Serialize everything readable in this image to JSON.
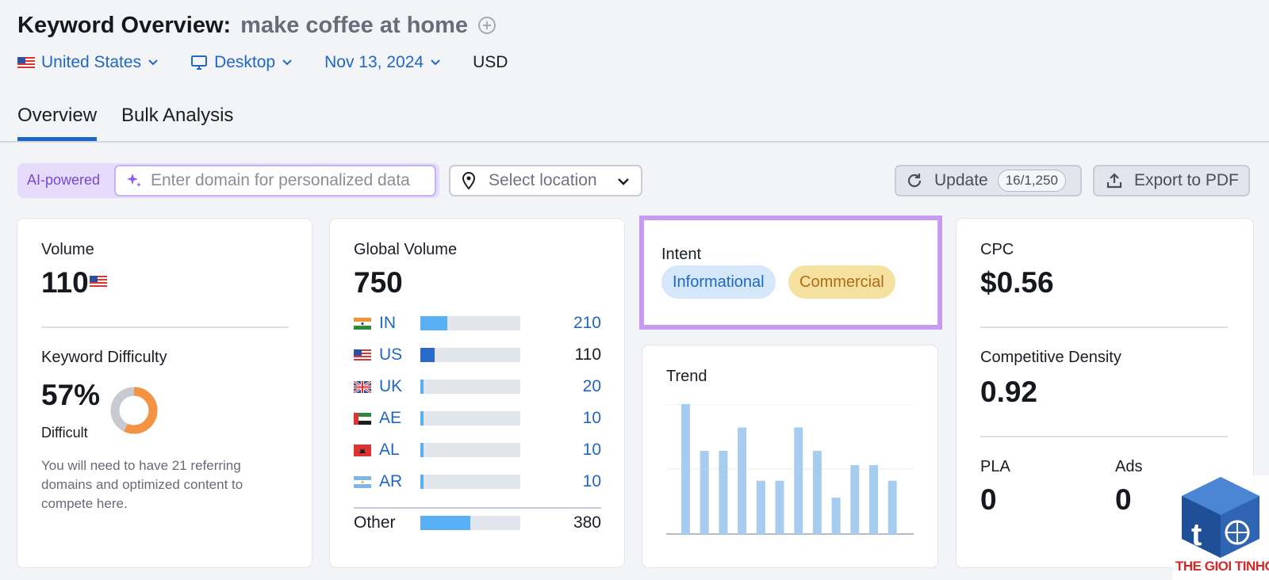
{
  "header": {
    "title_label": "Keyword Overview:",
    "keyword": "make coffee at home"
  },
  "filters": {
    "country": "United States",
    "device": "Desktop",
    "date": "Nov 13, 2024",
    "currency": "USD"
  },
  "tabs": [
    {
      "label": "Overview",
      "active": true
    },
    {
      "label": "Bulk Analysis",
      "active": false
    }
  ],
  "toolbar": {
    "ai_label": "AI-powered",
    "domain_placeholder": "Enter domain for personalized data",
    "location_placeholder": "Select location",
    "update_label": "Update",
    "update_count": "16/1,250",
    "export_label": "Export to PDF"
  },
  "volume": {
    "label": "Volume",
    "value": "110",
    "kd_label": "Keyword Difficulty",
    "kd_value": "57%",
    "kd_level": "Difficult",
    "kd_percent": 57,
    "kd_description": "You will need to have 21 referring domains and optimized content to compete here."
  },
  "global_volume": {
    "label": "Global Volume",
    "value": "750",
    "rows": [
      {
        "code": "IN",
        "value": "210",
        "fraction": 0.27,
        "color": "#5ab0f5",
        "link": true
      },
      {
        "code": "US",
        "value": "110",
        "fraction": 0.14,
        "color": "#2a6ac9",
        "link": false
      },
      {
        "code": "UK",
        "value": "20",
        "fraction": 0.03,
        "color": "#5ab0f5",
        "link": true
      },
      {
        "code": "AE",
        "value": "10",
        "fraction": 0.03,
        "color": "#5ab0f5",
        "link": true
      },
      {
        "code": "AL",
        "value": "10",
        "fraction": 0.03,
        "color": "#5ab0f5",
        "link": true
      },
      {
        "code": "AR",
        "value": "10",
        "fraction": 0.03,
        "color": "#5ab0f5",
        "link": true
      }
    ],
    "other_label": "Other",
    "other_value": "380",
    "other_fraction": 0.5
  },
  "intent": {
    "label": "Intent",
    "tags": [
      "Informational",
      "Commercial"
    ]
  },
  "trend": {
    "label": "Trend"
  },
  "chart_data": {
    "type": "bar",
    "title": "Trend",
    "values": [
      100,
      64,
      64,
      82,
      41,
      41,
      82,
      64,
      28,
      53,
      53,
      41
    ],
    "ylim": [
      0,
      100
    ],
    "color": "#a6cdf0"
  },
  "cpc": {
    "label": "CPC",
    "value": "$0.56",
    "density_label": "Competitive Density",
    "density_value": "0.92",
    "pla_label": "PLA",
    "pla_value": "0",
    "ads_label": "Ads",
    "ads_value": "0"
  },
  "watermark": {
    "text": "THE GIOI TINHOC"
  },
  "colors": {
    "link": "#1f67c4",
    "accent_purple": "#c69bf1",
    "kd_orange": "#f29444"
  }
}
